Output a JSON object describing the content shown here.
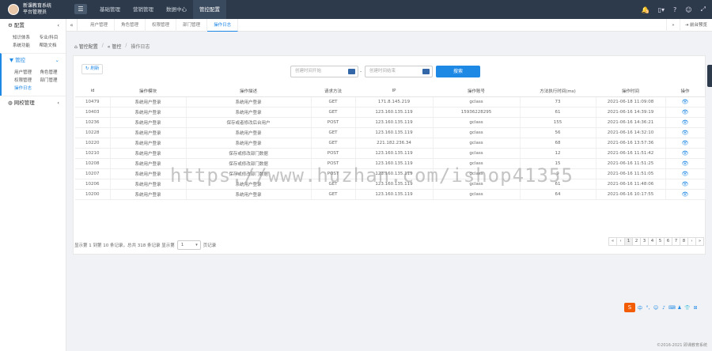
{
  "header": {
    "brand_line1": "新课教育系统",
    "brand_line2": "平台管理员",
    "menu_icon": "hamburger-icon",
    "nav": [
      "基础管理",
      "营销管理",
      "数据中心",
      "管控配置"
    ],
    "active_nav": 3,
    "notification_badge": "5",
    "icons": [
      "bell-icon",
      "mobile-icon",
      "help-icon",
      "user-icon",
      "expand-icon"
    ]
  },
  "sidebar": {
    "sections": [
      {
        "title": "配置",
        "icon": "gear-icon",
        "items": [
          "知识体系",
          "专业/科目",
          "系统功能",
          "帮助文档"
        ]
      },
      {
        "title": "管控",
        "icon": "filter-icon",
        "items": [
          "用户管理",
          "角色管理",
          "权限管理",
          "部门管理",
          "操作日志"
        ],
        "active_item": 4
      },
      {
        "title": "网校管理",
        "icon": "globe-icon",
        "items": []
      }
    ]
  },
  "tabs": {
    "items": [
      "用户管理",
      "角色管理",
      "权限管理",
      "部门管理",
      "操作日志"
    ],
    "active": 4,
    "right_label": "前台预览"
  },
  "breadcrumb": {
    "home": "管控配置",
    "mid": "管控",
    "current": "操作日志"
  },
  "toolbar": {
    "refresh_label": "刷新",
    "start_placeholder": "创建时间开始",
    "end_placeholder": "创建时间结束",
    "dash": "-",
    "search_label": "搜索"
  },
  "table": {
    "columns": [
      "id",
      "操作模块",
      "操作描述",
      "请求方法",
      "IP",
      "操作账号",
      "方法执行时间(ms)",
      "操作时间",
      "操作"
    ],
    "rows": [
      [
        "10479",
        "系统用户登录",
        "系统用户登录",
        "GET",
        "171.8.145.219",
        "gclass",
        "73",
        "2021-06-18 11:09:08"
      ],
      [
        "10403",
        "系统用户登录",
        "系统用户登录",
        "GET",
        "123.160.135.119",
        "15936228295",
        "61",
        "2021-06-16 14:39:19"
      ],
      [
        "10236",
        "系统用户登录",
        "保存或者修改后台用户",
        "POST",
        "123.160.135.119",
        "gclass",
        "155",
        "2021-06-16 14:36:21"
      ],
      [
        "10228",
        "系统用户登录",
        "系统用户登录",
        "GET",
        "123.160.135.119",
        "gclass",
        "56",
        "2021-06-16 14:32:10"
      ],
      [
        "10220",
        "系统用户登录",
        "系统用户登录",
        "GET",
        "221.182.236.34",
        "gclass",
        "68",
        "2021-06-16 13:57:36"
      ],
      [
        "10210",
        "系统用户登录",
        "保存或修改部门数据",
        "POST",
        "123.160.135.119",
        "gclass",
        "12",
        "2021-06-16 11:51:42"
      ],
      [
        "10208",
        "系统用户登录",
        "保存或修改部门数据",
        "POST",
        "123.160.135.119",
        "gclass",
        "15",
        "2021-06-16 11:51:25"
      ],
      [
        "10207",
        "系统用户登录",
        "保存或修改部门数据",
        "POST",
        "123.160.135.119",
        "gclass",
        "9",
        "2021-06-16 11:51:05"
      ],
      [
        "10206",
        "系统用户登录",
        "系统用户登录",
        "GET",
        "123.160.135.119",
        "gclass",
        "61",
        "2021-06-16 11:48:06"
      ],
      [
        "10200",
        "系统用户登录",
        "系统用户登录",
        "GET",
        "123.160.135.119",
        "gclass",
        "64",
        "2021-06-16 10:17:55"
      ]
    ],
    "action_icon": "eye-icon"
  },
  "pager": {
    "info_prefix": "显示第 1 到第 10 条记录，总共 318 条记录 显示第",
    "page_size": "1",
    "info_suffix": "页记录",
    "pages": [
      "«",
      "‹",
      "1",
      "2",
      "3",
      "4",
      "5",
      "6",
      "7",
      "8",
      "›",
      "»"
    ],
    "active_page": 2
  },
  "watermark": "https://www.huzhan.com/ishop41355",
  "ime": {
    "logo": "S",
    "items": [
      "中",
      "°,",
      "☺",
      "♪",
      "⌨",
      "♟",
      "👕",
      "⊞"
    ]
  },
  "footer": {
    "copyright": "©2016-2021 即课教育系统"
  }
}
